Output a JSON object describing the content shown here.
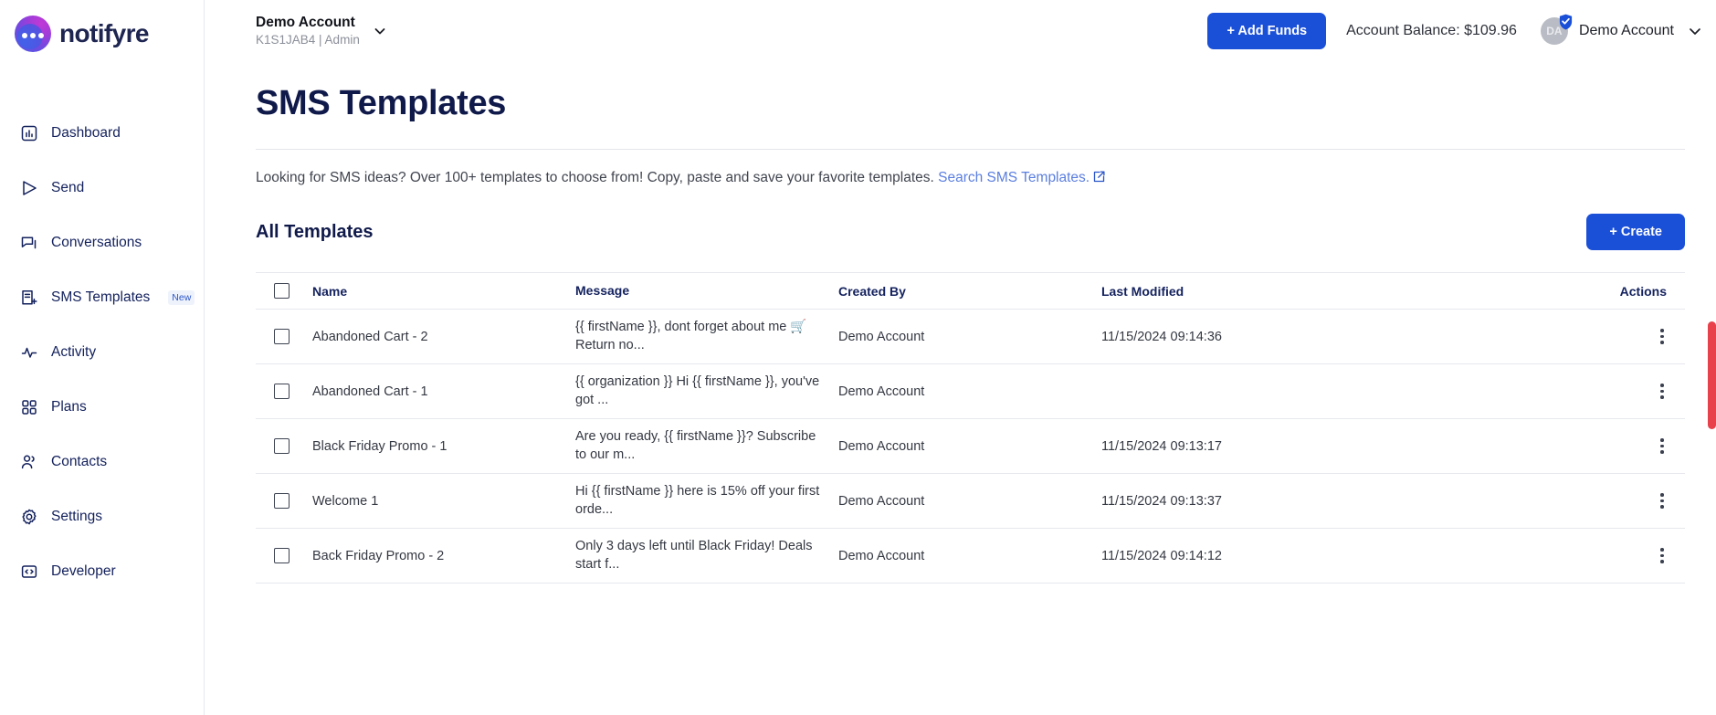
{
  "brand": {
    "name": "notifyre",
    "logo_icon": "notifyre-logo-icon"
  },
  "sidebar": {
    "items": [
      {
        "label": "Dashboard",
        "icon": "dashboard-icon"
      },
      {
        "label": "Send",
        "icon": "send-icon"
      },
      {
        "label": "Conversations",
        "icon": "conversations-icon"
      },
      {
        "label": "SMS Templates",
        "icon": "sms-templates-icon",
        "badge": "New"
      },
      {
        "label": "Activity",
        "icon": "activity-icon"
      },
      {
        "label": "Plans",
        "icon": "plans-icon"
      },
      {
        "label": "Contacts",
        "icon": "contacts-icon"
      },
      {
        "label": "Settings",
        "icon": "gear-icon"
      },
      {
        "label": "Developer",
        "icon": "code-icon"
      }
    ]
  },
  "header": {
    "account_name": "Demo Account",
    "account_sub": "K1S1JAB4 | Admin",
    "account_chevron_icon": "chevron-down-icon",
    "add_funds_label": "+ Add Funds",
    "balance_label": "Account Balance: $109.96",
    "avatar_initials": "DA",
    "avatar_badge_icon": "verified-shield-icon",
    "user_name": "Demo Account",
    "user_chevron_icon": "chevron-down-icon"
  },
  "page": {
    "title": "SMS Templates",
    "description_text": "Looking for SMS ideas? Over 100+ templates to choose from! Copy, paste and save your favorite templates. ",
    "description_link": "Search SMS Templates.",
    "external_link_icon": "external-link-icon",
    "section_title": "All Templates",
    "create_label": "+ Create"
  },
  "table": {
    "select_all_icon": "checkbox-icon",
    "columns": [
      "Name",
      "Message",
      "Created By",
      "Last Modified",
      "Actions"
    ],
    "rows": [
      {
        "name": "Abandoned Cart - 2",
        "message": "{{ firstName }}, dont forget about me 🛒 Return no...",
        "created_by": "Demo Account",
        "last_modified": "11/15/2024 09:14:36",
        "actions_icon": "kebab-menu-icon"
      },
      {
        "name": "Abandoned Cart - 1",
        "message": "{{ organization }} Hi {{ firstName }}, you've got ...",
        "created_by": "Demo Account",
        "last_modified": "",
        "actions_icon": "kebab-menu-icon"
      },
      {
        "name": "Black Friday Promo - 1",
        "message": "Are you ready, {{ firstName }}? Subscribe to our m...",
        "created_by": "Demo Account",
        "last_modified": "11/15/2024 09:13:17",
        "actions_icon": "kebab-menu-icon"
      },
      {
        "name": "Welcome 1",
        "message": "Hi {{ firstName }} here is 15% off your first orde...",
        "created_by": "Demo Account",
        "last_modified": "11/15/2024 09:13:37",
        "actions_icon": "kebab-menu-icon"
      },
      {
        "name": "Back Friday Promo - 2",
        "message": "Only 3 days left until Black Friday! Deals start f...",
        "created_by": "Demo Account",
        "last_modified": "11/15/2024 09:14:12",
        "actions_icon": "kebab-menu-icon"
      }
    ]
  },
  "colors": {
    "accent_blue": "#1a4fd8",
    "link_blue": "#5b7fe0",
    "navy": "#101a4a",
    "scrollbar_red": "#e8414c"
  }
}
